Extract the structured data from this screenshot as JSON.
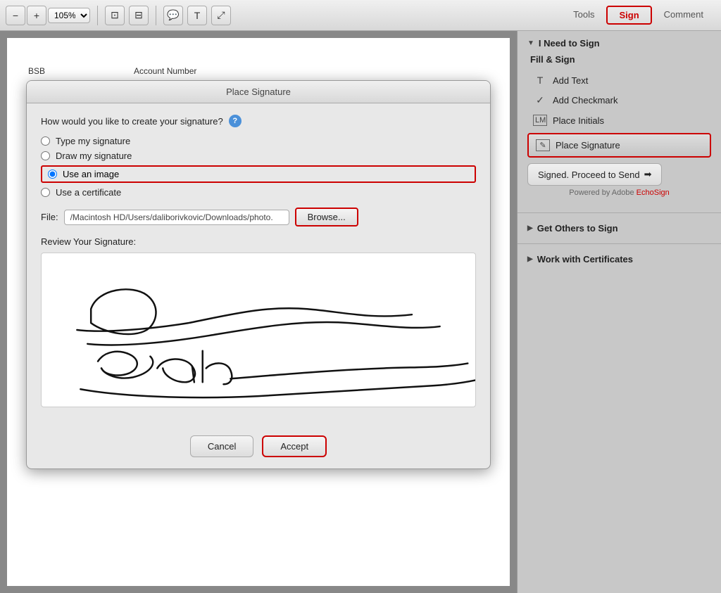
{
  "toolbar": {
    "zoom_value": "105%",
    "tabs": [
      {
        "id": "tools",
        "label": "Tools",
        "active": false
      },
      {
        "id": "sign",
        "label": "Sign",
        "active": true
      },
      {
        "id": "comment",
        "label": "Comment",
        "active": false
      }
    ]
  },
  "document": {
    "fields": [
      {
        "label": "BSB",
        "value": ""
      },
      {
        "label": "Account Number",
        "value": ""
      }
    ]
  },
  "dialog": {
    "title": "Place Signature",
    "question": "How would you like to create your signature?",
    "options": [
      {
        "id": "type",
        "label": "Type my signature",
        "selected": false
      },
      {
        "id": "draw",
        "label": "Draw my signature",
        "selected": false
      },
      {
        "id": "image",
        "label": "Use an image",
        "selected": true
      },
      {
        "id": "cert",
        "label": "Use a certificate",
        "selected": false
      }
    ],
    "file_label": "File:",
    "file_path": "/Macintosh HD/Users/daliborivkovic/Downloads/photo.",
    "browse_label": "Browse...",
    "review_label": "Review Your Signature:",
    "cancel_label": "Cancel",
    "accept_label": "Accept"
  },
  "right_panel": {
    "need_to_sign": {
      "header": "I Need to Sign",
      "fill_sign": "Fill & Sign",
      "items": [
        {
          "id": "add-text",
          "icon": "T",
          "label": "Add Text"
        },
        {
          "id": "add-checkmark",
          "icon": "✓",
          "label": "Add Checkmark"
        },
        {
          "id": "place-initials",
          "icon": "LM",
          "label": "Place Initials"
        }
      ],
      "place_signature": "Place Signature",
      "place_signature_icon": "✎",
      "proceed_label": "Signed. Proceed to Send",
      "powered_by": "Powered by Adobe",
      "echosign": "EchoSign"
    },
    "get_others": {
      "header": "Get Others to Sign"
    },
    "work_certs": {
      "header": "Work with Certificates"
    }
  }
}
